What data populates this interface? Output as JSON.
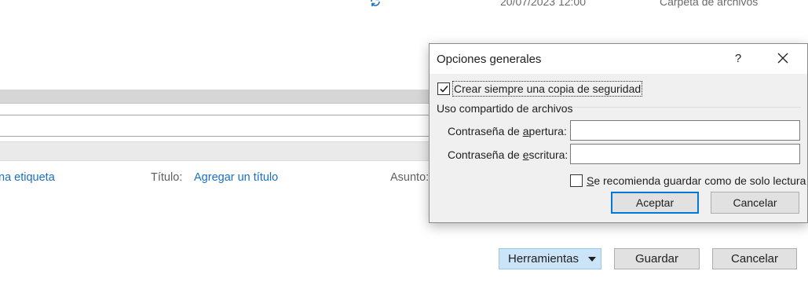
{
  "background": {
    "file_row": {
      "modified": "20/07/2023 12:00",
      "type": "Carpeta de archivos",
      "status_icon": "sync-icon"
    },
    "metadata": {
      "tags_link": "na etiqueta",
      "title_label": "Título:",
      "title_link": "Agregar un título",
      "subject_label": "Asunto:"
    },
    "buttons": {
      "tools": "Herramientas",
      "save": "Guardar",
      "cancel": "Cancelar"
    }
  },
  "dialog": {
    "title": "Opciones generales",
    "help": "?",
    "backup_checkbox": {
      "label": "Crear siempre una copia de seguridad",
      "checked": true
    },
    "sharing_group_label": "Uso compartido de archivos",
    "open_password": {
      "label_pre": "Contraseña de ",
      "label_key": "a",
      "label_post": "pertura:",
      "value": ""
    },
    "write_password": {
      "label_pre": "Contraseña de ",
      "label_key": "e",
      "label_post": "scritura:",
      "value": ""
    },
    "readonly_checkbox": {
      "label_key": "S",
      "label_post": "e recomienda guardar como de solo lectura",
      "checked": false
    },
    "ok": "Aceptar",
    "cancel": "Cancelar"
  },
  "colors": {
    "link": "#1a6fc4",
    "focus_border": "#0078d7",
    "tools_button_bg": "#cce4f7"
  }
}
